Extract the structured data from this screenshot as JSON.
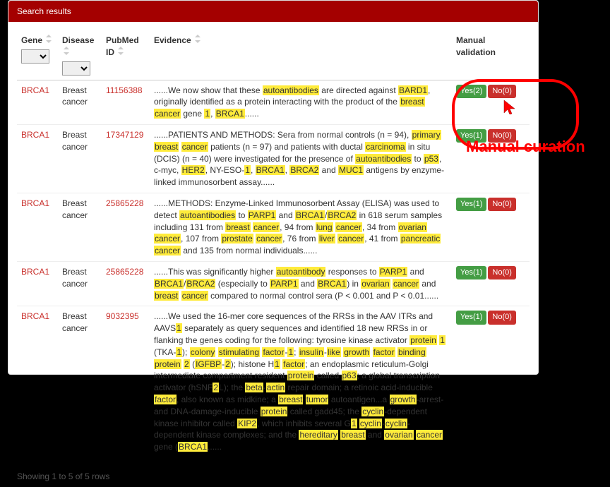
{
  "header": {
    "title": "Search results"
  },
  "columns": {
    "gene": "Gene",
    "disease": "Disease",
    "pmid": "PubMed ID",
    "evidence": "Evidence",
    "validation": "Manual validation"
  },
  "rows": [
    {
      "gene": "BRCA1",
      "disease": "Breast cancer",
      "pmid": "11156388",
      "evidence": "......We now show that these <hl>autoantibodies</hl> are directed against <hl>BARD1</hl>, originally identified as a protein interacting with the product of the <hl>breast</hl> <hl>cancer</hl> gene <hl>1</hl>, <hl>BRCA1</hl>......",
      "yes": "Yes(2)",
      "no": "No(0)"
    },
    {
      "gene": "BRCA1",
      "disease": "Breast cancer",
      "pmid": "17347129",
      "evidence": "......PATIENTS AND METHODS: Sera from normal controls (n = 94), <hl>primary</hl> <hl>breast</hl> <hl>cancer</hl> patients (n = 97) and patients with ductal <hl>carcinoma</hl> in situ (DCIS) (n = 40) were investigated for the presence of <hl>autoantibodies</hl> to <hl>p53</hl>, c-myc, <hl>HER2</hl>, NY-ESO-<hl>1</hl>, <hl>BRCA1</hl>, <hl>BRCA2</hl> and <hl>MUC1</hl> antigens by enzyme-linked immunosorbent assay......",
      "yes": "Yes(1)",
      "no": "No(0)"
    },
    {
      "gene": "BRCA1",
      "disease": "Breast cancer",
      "pmid": "25865228",
      "evidence": "......METHODS: Enzyme-Linked Immunosorbent Assay (ELISA) was used to detect <hl>autoantibodies</hl> to <hl>PARP1</hl> and <hl>BRCA1</hl>/<hl>BRCA2</hl> in 618 serum samples including 131 from <hl>breast</hl> <hl>cancer</hl>, 94 from <hl>lung</hl> <hl>cancer</hl>, 34 from <hl>ovarian</hl> <hl>cancer</hl>, 107 from <hl>prostate</hl> <hl>cancer</hl>, 76 from <hl>liver</hl> <hl>cancer</hl>, 41 from <hl>pancreatic</hl> <hl>cancer</hl> and 135 from normal individuals......",
      "yes": "Yes(1)",
      "no": "No(0)"
    },
    {
      "gene": "BRCA1",
      "disease": "Breast cancer",
      "pmid": "25865228",
      "evidence": "......This was significantly higher <hl>autoantibody</hl> responses to <hl>PARP1</hl> and <hl>BRCA1</hl>/<hl>BRCA2</hl> (especially to <hl>PARP1</hl> and <hl>BRCA1</hl>) in <hl>ovarian</hl> <hl>cancer</hl> and <hl>breast</hl> <hl>cancer</hl> compared to normal control sera (P < 0.001 and P < 0.01......",
      "yes": "Yes(1)",
      "no": "No(0)"
    },
    {
      "gene": "BRCA1",
      "disease": "Breast cancer",
      "pmid": "9032395",
      "evidence": "......We used the 16-mer core sequences of the RRSs in the AAV ITRs and AAVS<hl>1</hl> separately as query sequences and identified 18 new RRSs in or flanking the genes coding for the following: tyrosine kinase activator <hl>protein</hl> <hl>1</hl> (TKA-<hl>1</hl>); <hl>colony</hl> <hl>stimulating</hl> <hl>factor</hl>-<hl>1</hl>; <hl>insulin</hl>-<hl>like</hl> <hl>growth</hl> <hl>factor</hl> <hl>binding</hl> <hl>protein</hl> <hl>2</hl> (<hl>IGFBP</hl>-<hl>2</hl>); histone H<hl>1</hl> <hl>factor</hl>; an endoplasmic reticulum-Golgi intermediate compartment resident <hl>protein</hl> called <hl>p63</hl>; a global transcription activator (hSNF<hl>2</hl>L); the <hl>beta</hl>-<hl>actin</hl> repair domain; a retinoic acid-inducible <hl>factor</hl>, also known as midkine; a <hl>breast</hl> <hl>tumor</hl> autoantigen...a <hl>growth</hl>-arrest- and DNA-damage-inducible <hl>protein</hl> called gadd45; the <hl>cyclin</hl>-dependent kinase inhibitor called <hl>KIP2</hl>, which inhibits several G<hl>1</hl> <hl>cyclin</hl>-<hl>cyclin</hl>-dependent kinase complexes; and the <hl>hereditary</hl> <hl>breast</hl> and <hl>ovarian</hl> <hl>cancer</hl> gene (<hl>BRCA1</hl>......",
      "yes": "Yes(1)",
      "no": "No(0)"
    }
  ],
  "footer": {
    "info": "Showing 1 to 5 of 5 rows"
  },
  "annotation": {
    "label": "Manual curation"
  }
}
